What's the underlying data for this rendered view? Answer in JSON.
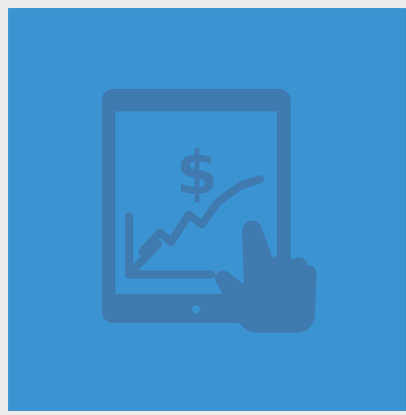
{
  "tile": {
    "background_color": "#3b93d2",
    "icon_color": "#3f7bb0",
    "icon": "tablet-growth-chart-touch-icon"
  },
  "page": {
    "background_color": "#ececec"
  }
}
